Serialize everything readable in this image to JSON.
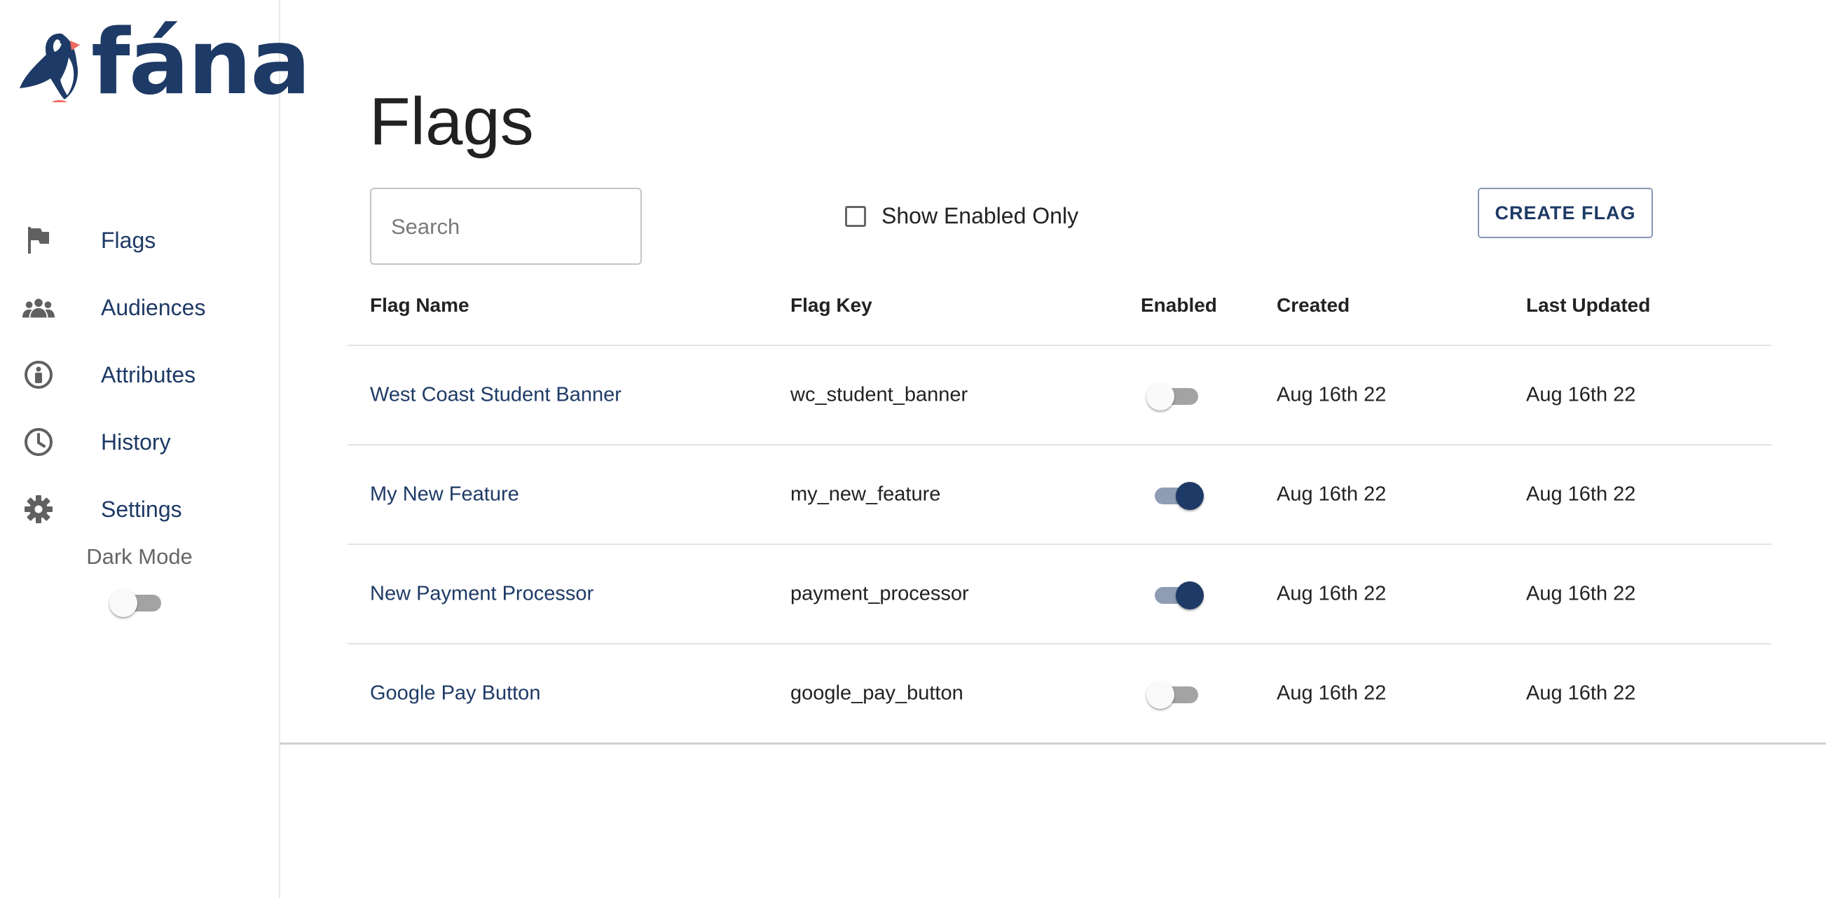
{
  "brand": {
    "name": "fána"
  },
  "sidebar": {
    "items": [
      {
        "label": "Flags",
        "icon": "flag-icon"
      },
      {
        "label": "Audiences",
        "icon": "people-icon"
      },
      {
        "label": "Attributes",
        "icon": "accessibility-icon"
      },
      {
        "label": "History",
        "icon": "clock-icon"
      },
      {
        "label": "Settings",
        "icon": "gear-icon"
      }
    ],
    "dark_mode": {
      "label": "Dark Mode",
      "enabled": false
    }
  },
  "main": {
    "title": "Flags",
    "search": {
      "placeholder": "Search",
      "value": ""
    },
    "filter": {
      "label": "Show Enabled Only",
      "checked": false
    },
    "create_button": "CREATE FLAG",
    "table": {
      "columns": [
        "Flag Name",
        "Flag Key",
        "Enabled",
        "Created",
        "Last Updated"
      ],
      "rows": [
        {
          "name": "West Coast Student Banner",
          "key": "wc_student_banner",
          "enabled": false,
          "created": "Aug 16th 22",
          "updated": "Aug 16th 22"
        },
        {
          "name": "My New Feature",
          "key": "my_new_feature",
          "enabled": true,
          "created": "Aug 16th 22",
          "updated": "Aug 16th 22"
        },
        {
          "name": "New Payment Processor",
          "key": "payment_processor",
          "enabled": true,
          "created": "Aug 16th 22",
          "updated": "Aug 16th 22"
        },
        {
          "name": "Google Pay Button",
          "key": "google_pay_button",
          "enabled": false,
          "created": "Aug 16th 22",
          "updated": "Aug 16th 22"
        }
      ]
    }
  },
  "colors": {
    "brand_navy": "#1e3a66",
    "accent_coral": "#f06a5c",
    "switch_off_track": "#a3a3a3",
    "switch_on_track": "#8e9db3"
  }
}
